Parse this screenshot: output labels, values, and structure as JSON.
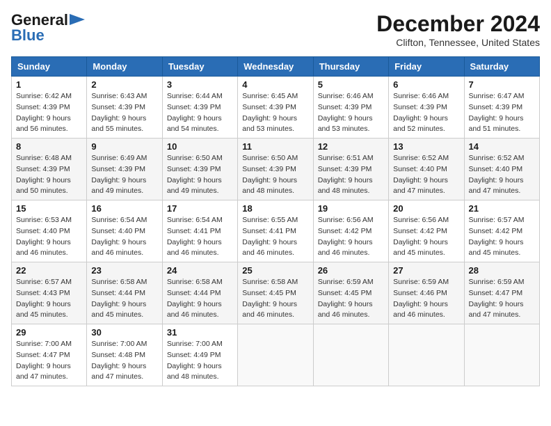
{
  "header": {
    "logo_general": "General",
    "logo_blue": "Blue",
    "month_title": "December 2024",
    "location": "Clifton, Tennessee, United States"
  },
  "weekdays": [
    "Sunday",
    "Monday",
    "Tuesday",
    "Wednesday",
    "Thursday",
    "Friday",
    "Saturday"
  ],
  "weeks": [
    [
      {
        "day": "1",
        "sunrise": "6:42 AM",
        "sunset": "4:39 PM",
        "daylight": "9 hours and 56 minutes."
      },
      {
        "day": "2",
        "sunrise": "6:43 AM",
        "sunset": "4:39 PM",
        "daylight": "9 hours and 55 minutes."
      },
      {
        "day": "3",
        "sunrise": "6:44 AM",
        "sunset": "4:39 PM",
        "daylight": "9 hours and 54 minutes."
      },
      {
        "day": "4",
        "sunrise": "6:45 AM",
        "sunset": "4:39 PM",
        "daylight": "9 hours and 53 minutes."
      },
      {
        "day": "5",
        "sunrise": "6:46 AM",
        "sunset": "4:39 PM",
        "daylight": "9 hours and 53 minutes."
      },
      {
        "day": "6",
        "sunrise": "6:46 AM",
        "sunset": "4:39 PM",
        "daylight": "9 hours and 52 minutes."
      },
      {
        "day": "7",
        "sunrise": "6:47 AM",
        "sunset": "4:39 PM",
        "daylight": "9 hours and 51 minutes."
      }
    ],
    [
      {
        "day": "8",
        "sunrise": "6:48 AM",
        "sunset": "4:39 PM",
        "daylight": "9 hours and 50 minutes."
      },
      {
        "day": "9",
        "sunrise": "6:49 AM",
        "sunset": "4:39 PM",
        "daylight": "9 hours and 49 minutes."
      },
      {
        "day": "10",
        "sunrise": "6:50 AM",
        "sunset": "4:39 PM",
        "daylight": "9 hours and 49 minutes."
      },
      {
        "day": "11",
        "sunrise": "6:50 AM",
        "sunset": "4:39 PM",
        "daylight": "9 hours and 48 minutes."
      },
      {
        "day": "12",
        "sunrise": "6:51 AM",
        "sunset": "4:39 PM",
        "daylight": "9 hours and 48 minutes."
      },
      {
        "day": "13",
        "sunrise": "6:52 AM",
        "sunset": "4:40 PM",
        "daylight": "9 hours and 47 minutes."
      },
      {
        "day": "14",
        "sunrise": "6:52 AM",
        "sunset": "4:40 PM",
        "daylight": "9 hours and 47 minutes."
      }
    ],
    [
      {
        "day": "15",
        "sunrise": "6:53 AM",
        "sunset": "4:40 PM",
        "daylight": "9 hours and 46 minutes."
      },
      {
        "day": "16",
        "sunrise": "6:54 AM",
        "sunset": "4:40 PM",
        "daylight": "9 hours and 46 minutes."
      },
      {
        "day": "17",
        "sunrise": "6:54 AM",
        "sunset": "4:41 PM",
        "daylight": "9 hours and 46 minutes."
      },
      {
        "day": "18",
        "sunrise": "6:55 AM",
        "sunset": "4:41 PM",
        "daylight": "9 hours and 46 minutes."
      },
      {
        "day": "19",
        "sunrise": "6:56 AM",
        "sunset": "4:42 PM",
        "daylight": "9 hours and 46 minutes."
      },
      {
        "day": "20",
        "sunrise": "6:56 AM",
        "sunset": "4:42 PM",
        "daylight": "9 hours and 45 minutes."
      },
      {
        "day": "21",
        "sunrise": "6:57 AM",
        "sunset": "4:42 PM",
        "daylight": "9 hours and 45 minutes."
      }
    ],
    [
      {
        "day": "22",
        "sunrise": "6:57 AM",
        "sunset": "4:43 PM",
        "daylight": "9 hours and 45 minutes."
      },
      {
        "day": "23",
        "sunrise": "6:58 AM",
        "sunset": "4:44 PM",
        "daylight": "9 hours and 45 minutes."
      },
      {
        "day": "24",
        "sunrise": "6:58 AM",
        "sunset": "4:44 PM",
        "daylight": "9 hours and 46 minutes."
      },
      {
        "day": "25",
        "sunrise": "6:58 AM",
        "sunset": "4:45 PM",
        "daylight": "9 hours and 46 minutes."
      },
      {
        "day": "26",
        "sunrise": "6:59 AM",
        "sunset": "4:45 PM",
        "daylight": "9 hours and 46 minutes."
      },
      {
        "day": "27",
        "sunrise": "6:59 AM",
        "sunset": "4:46 PM",
        "daylight": "9 hours and 46 minutes."
      },
      {
        "day": "28",
        "sunrise": "6:59 AM",
        "sunset": "4:47 PM",
        "daylight": "9 hours and 47 minutes."
      }
    ],
    [
      {
        "day": "29",
        "sunrise": "7:00 AM",
        "sunset": "4:47 PM",
        "daylight": "9 hours and 47 minutes."
      },
      {
        "day": "30",
        "sunrise": "7:00 AM",
        "sunset": "4:48 PM",
        "daylight": "9 hours and 47 minutes."
      },
      {
        "day": "31",
        "sunrise": "7:00 AM",
        "sunset": "4:49 PM",
        "daylight": "9 hours and 48 minutes."
      },
      null,
      null,
      null,
      null
    ]
  ]
}
